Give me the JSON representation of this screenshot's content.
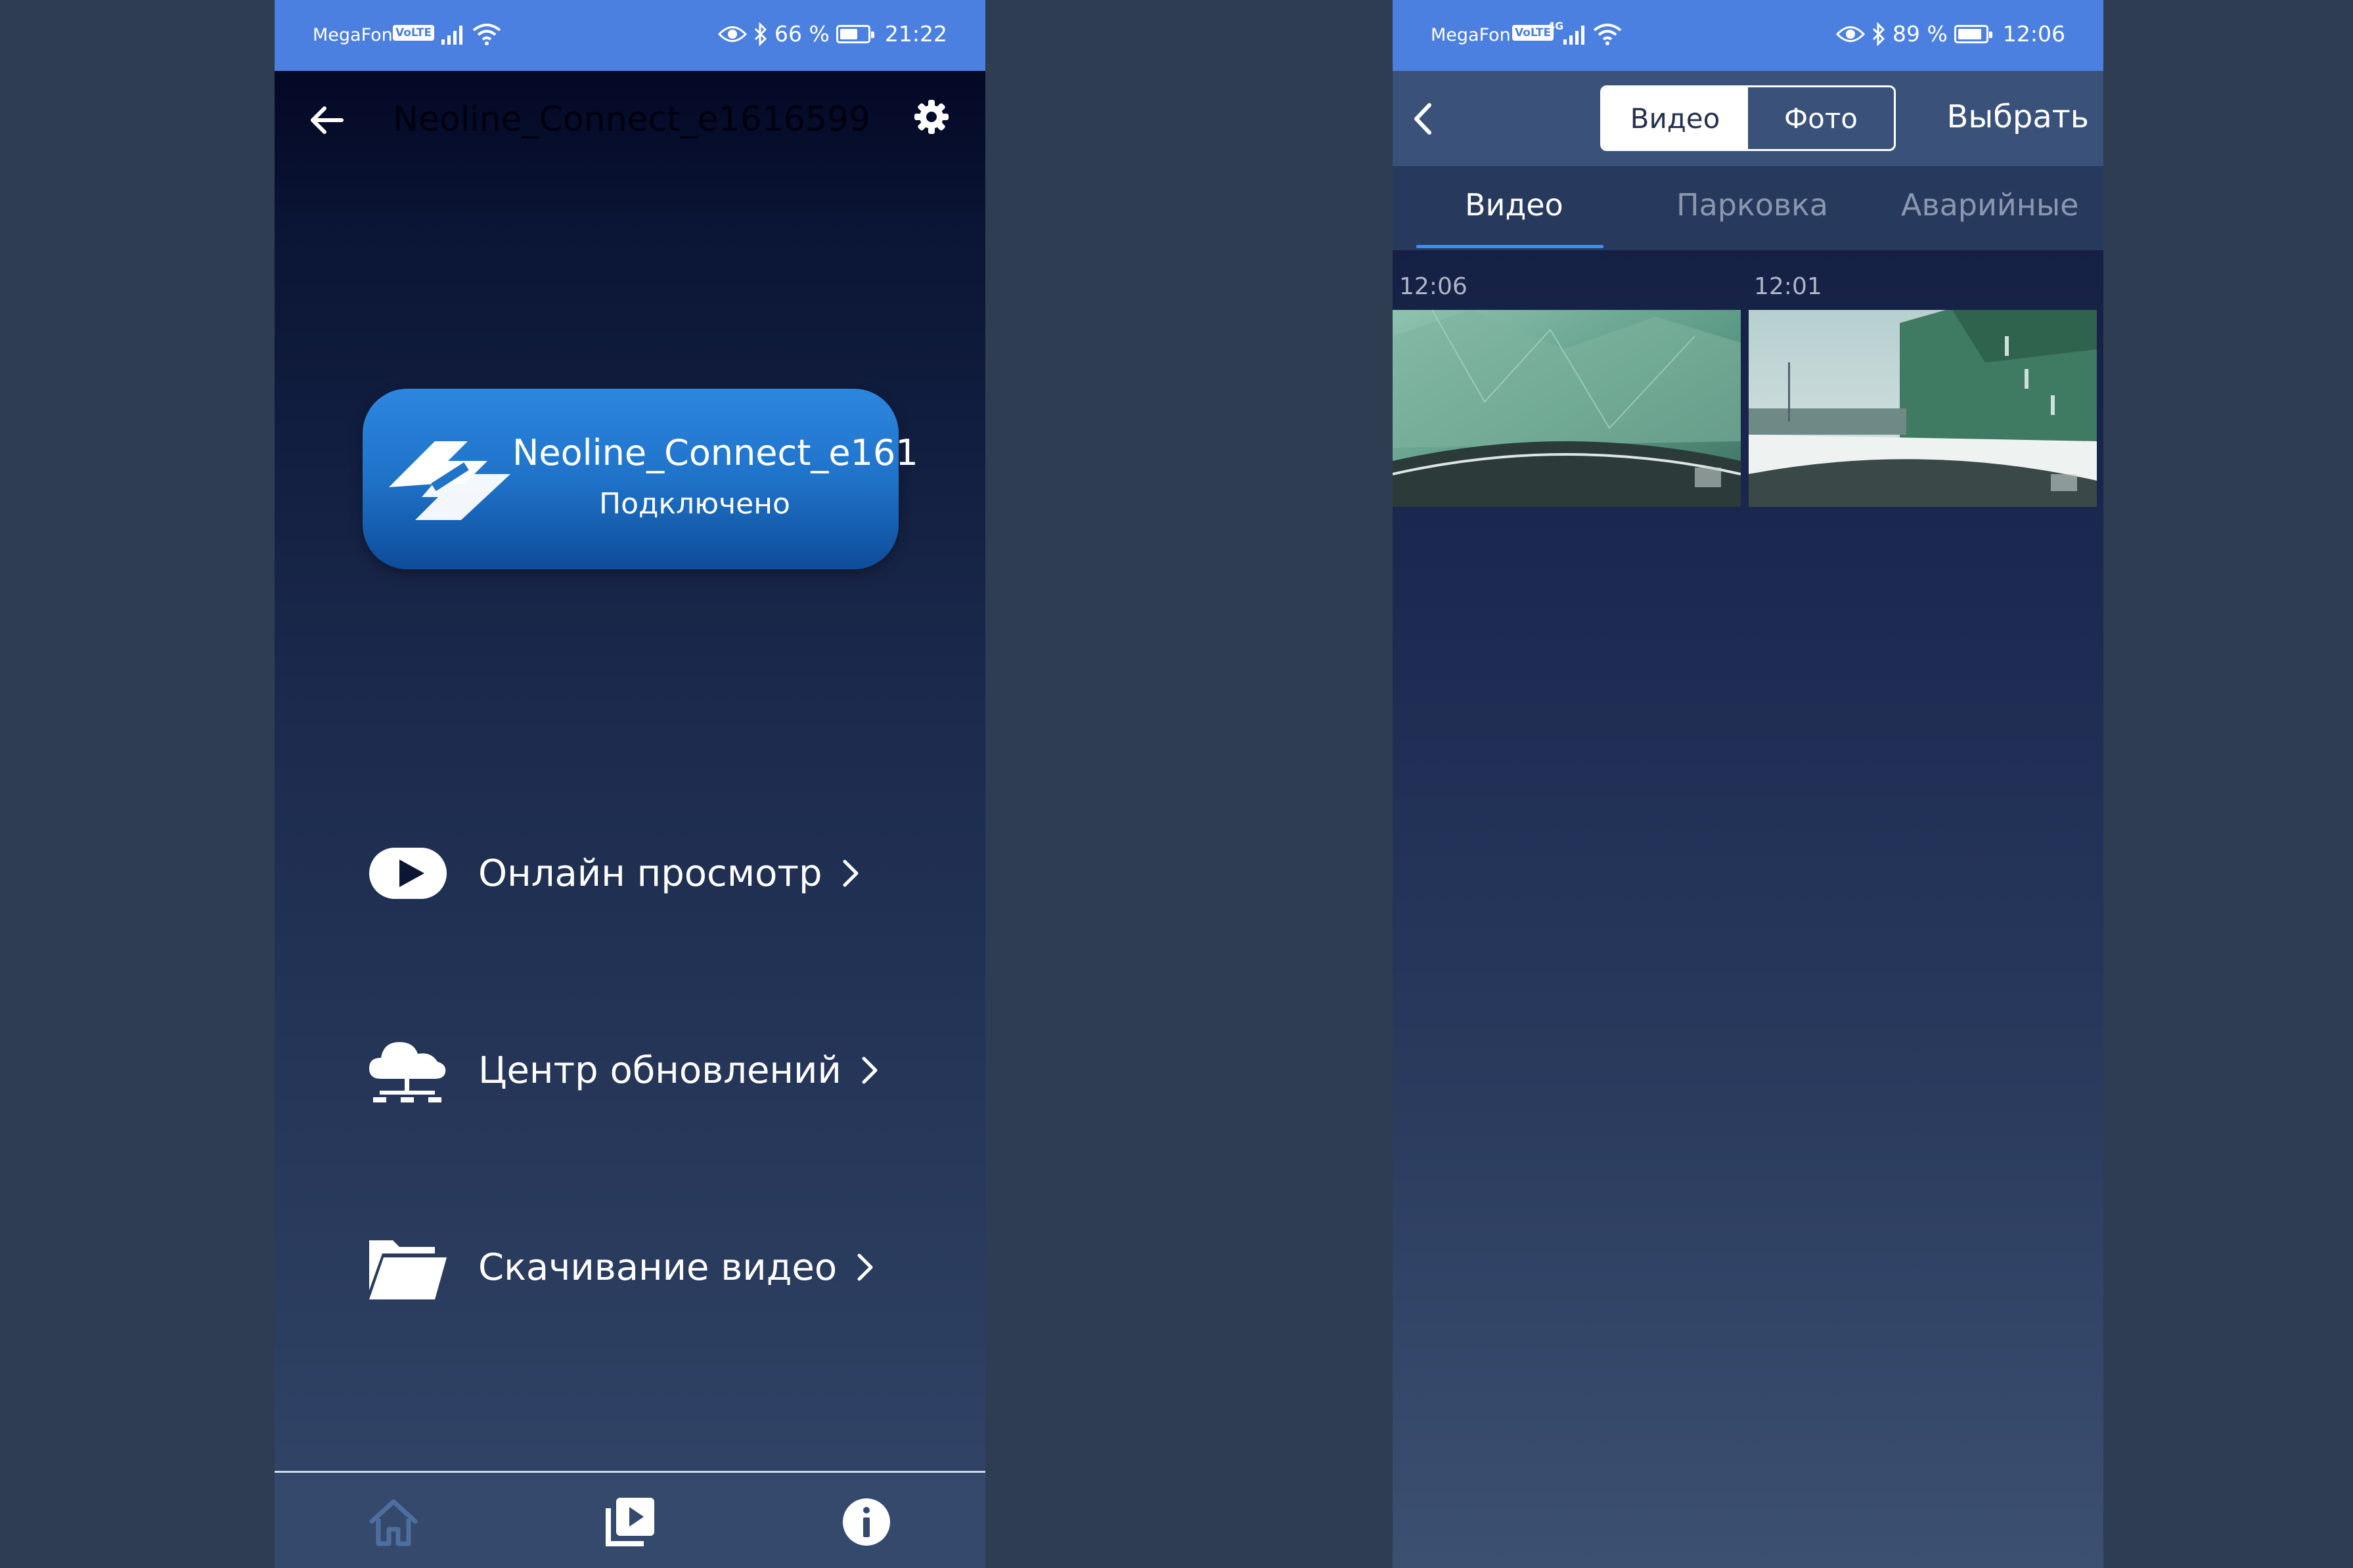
{
  "left_screen": {
    "status": {
      "carrier": "MegaFon",
      "volte": "VoLTE",
      "battery": "66 %",
      "battery_level": 0.66,
      "time": "21:22"
    },
    "header": {
      "title": "Neoline_Connect_e1616599"
    },
    "device": {
      "name": "Neoline_Connect_e161",
      "status": "Подключено"
    },
    "menu": [
      {
        "label": "Онлайн просмотр",
        "icon": "play-icon"
      },
      {
        "label": "Центр обновлений",
        "icon": "cloud-network-icon"
      },
      {
        "label": "Скачивание видео",
        "icon": "folder-icon"
      }
    ],
    "bottom_nav": [
      "home-icon",
      "video-library-icon",
      "info-icon"
    ]
  },
  "right_screen": {
    "status": {
      "carrier": "MegaFon",
      "volte": "VoLTE",
      "network": "4G",
      "battery": "89 %",
      "battery_level": 0.89,
      "time": "12:06"
    },
    "header": {
      "segment_video": "Видео",
      "segment_photo": "Фото",
      "select": "Выбрать"
    },
    "tabs": [
      "Видео",
      "Парковка",
      "Аварийные"
    ],
    "thumbnails": [
      {
        "time": "12:06"
      },
      {
        "time": "12:01"
      }
    ]
  },
  "colors": {
    "status_bar": "#4c80e0",
    "card": "#1f73c9",
    "tab_accent": "#3d8ef0"
  }
}
